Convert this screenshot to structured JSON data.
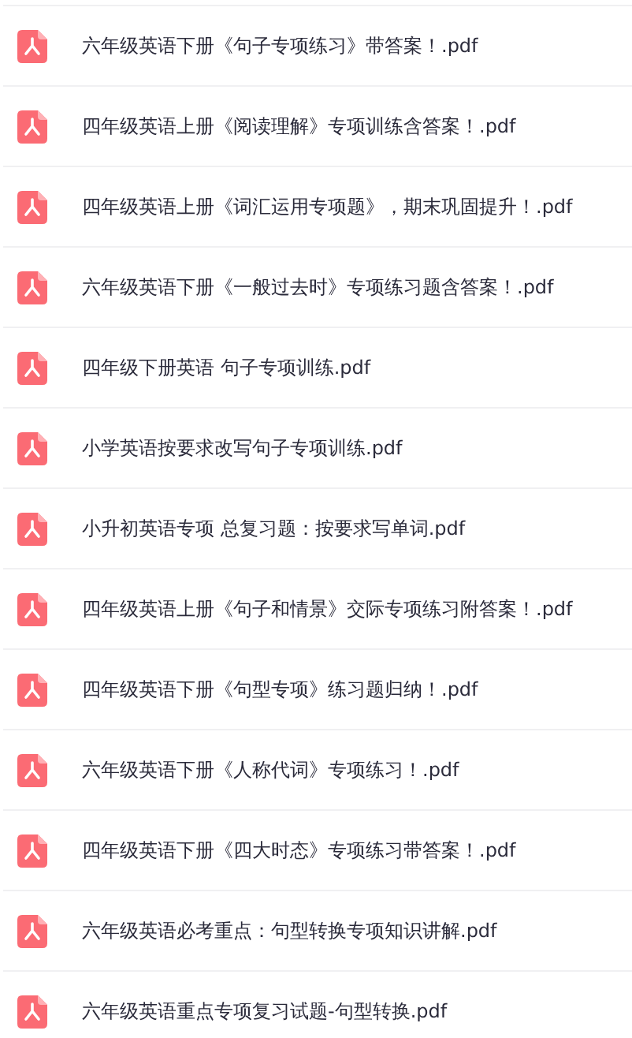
{
  "files": [
    {
      "name": "六年级英语下册《句子专项练习》带答案！.pdf"
    },
    {
      "name": "四年级英语上册《阅读理解》专项训练含答案！.pdf"
    },
    {
      "name": "四年级英语上册《词汇运用专项题》，期末巩固提升！.pdf"
    },
    {
      "name": "六年级英语下册《一般过去时》专项练习题含答案！.pdf"
    },
    {
      "name": "四年级下册英语 句子专项训练.pdf"
    },
    {
      "name": "小学英语按要求改写句子专项训练.pdf"
    },
    {
      "name": "小升初英语专项 总复习题：按要求写单词.pdf"
    },
    {
      "name": "四年级英语上册《句子和情景》交际专项练习附答案！.pdf"
    },
    {
      "name": "四年级英语下册《句型专项》练习题归纳！.pdf"
    },
    {
      "name": "六年级英语下册《人称代词》专项练习！.pdf"
    },
    {
      "name": "四年级英语下册《四大时态》专项练习带答案！.pdf"
    },
    {
      "name": "六年级英语必考重点：句型转换专项知识讲解.pdf"
    },
    {
      "name": "六年级英语重点专项复习试题-句型转换.pdf"
    }
  ]
}
